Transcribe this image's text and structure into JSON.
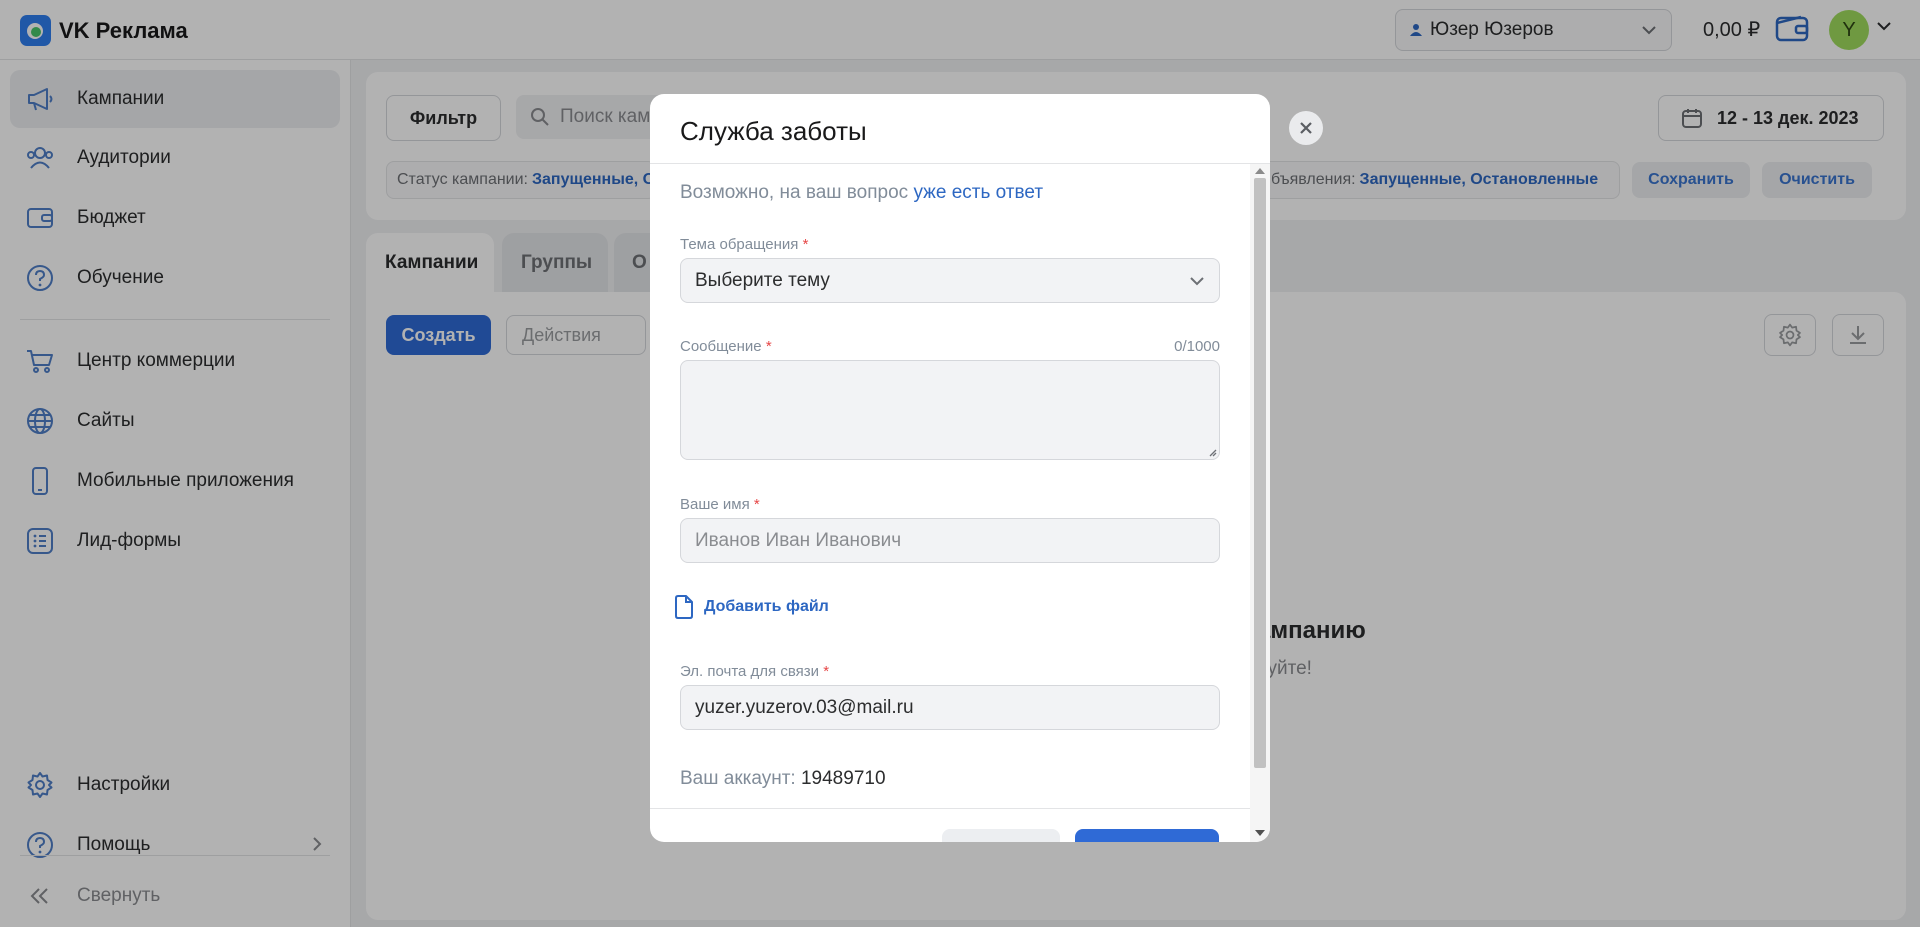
{
  "header": {
    "logo_text": "VK Реклама",
    "account_name": "Юзер Юзеров",
    "balance": "0,00 ₽",
    "avatar_letter": "Y"
  },
  "sidebar": {
    "items": [
      {
        "label": "Кампании",
        "icon": "megaphone-icon"
      },
      {
        "label": "Аудитории",
        "icon": "audience-icon"
      },
      {
        "label": "Бюджет",
        "icon": "wallet-icon"
      },
      {
        "label": "Обучение",
        "icon": "question-icon"
      },
      {
        "label": "Центр коммерции",
        "icon": "cart-icon"
      },
      {
        "label": "Сайты",
        "icon": "globe-icon"
      },
      {
        "label": "Мобильные приложения",
        "icon": "phone-icon"
      },
      {
        "label": "Лид-формы",
        "icon": "list-icon"
      }
    ],
    "settings_label": "Настройки",
    "help_label": "Помощь",
    "collapse_label": "Свернуть"
  },
  "filters": {
    "filter_button": "Фильтр",
    "search_placeholder": "Поиск кам",
    "date_range": "12 - 13 дек. 2023",
    "chip_campaign_label": "Статус кампании:",
    "chip_campaign_value": "Запущенные, О",
    "chip_ad_label": "бъявления:",
    "chip_ad_value": "Запущенные, Остановленные",
    "save_label": "Сохранить",
    "clear_label": "Очистить"
  },
  "tabs": [
    {
      "label": "Кампании"
    },
    {
      "label": "Группы"
    },
    {
      "label": "О"
    }
  ],
  "toolbar": {
    "create_label": "Создать",
    "actions_placeholder": "Действия"
  },
  "empty_state": {
    "title": "ампанию",
    "subtitle": "буйте!"
  },
  "modal": {
    "title": "Служба заботы",
    "hint_prefix": "Возможно, на ваш вопрос ",
    "hint_link": "уже есть ответ",
    "topic_label": "Тема обращения",
    "topic_value": "Выберите тему",
    "message_label": "Сообщение",
    "message_counter": "0/1000",
    "name_label": "Ваше имя",
    "name_placeholder": "Иванов Иван Иванович",
    "add_file_label": "Добавить файл",
    "email_label": "Эл. почта для связи",
    "email_value": "yuzer.yuzerov.03@mail.ru",
    "account_label": "Ваш аккаунт:",
    "account_value": "19489710",
    "required_mark": "*"
  },
  "colors": {
    "accent": "#2f6ad6",
    "link": "#2d67c2",
    "required": "#e64646",
    "avatar_bg": "#9fdc5e"
  }
}
